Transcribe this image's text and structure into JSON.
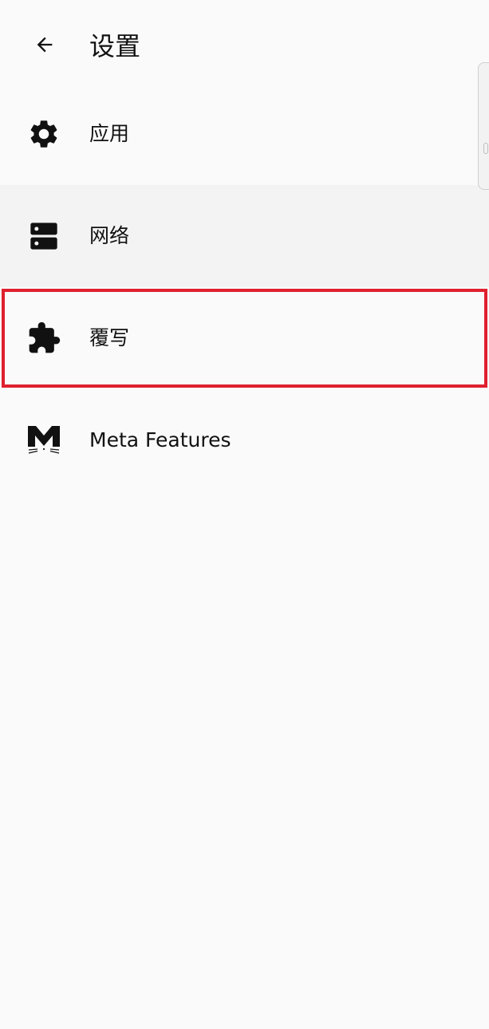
{
  "header": {
    "title": "设置",
    "back_icon": "arrow-left-icon"
  },
  "menu": {
    "items": [
      {
        "label": "应用",
        "icon": "gear-icon",
        "state": "normal"
      },
      {
        "label": "网络",
        "icon": "server-icon",
        "state": "selected"
      },
      {
        "label": "覆写",
        "icon": "puzzle-icon",
        "state": "highlighted"
      },
      {
        "label": "Meta Features",
        "icon": "meta-cat-logo-icon",
        "state": "normal"
      }
    ]
  },
  "colors": {
    "background": "#fafafa",
    "selected_row": "#f3f3f3",
    "highlight_outline": "#e0202e",
    "text": "#111111"
  }
}
